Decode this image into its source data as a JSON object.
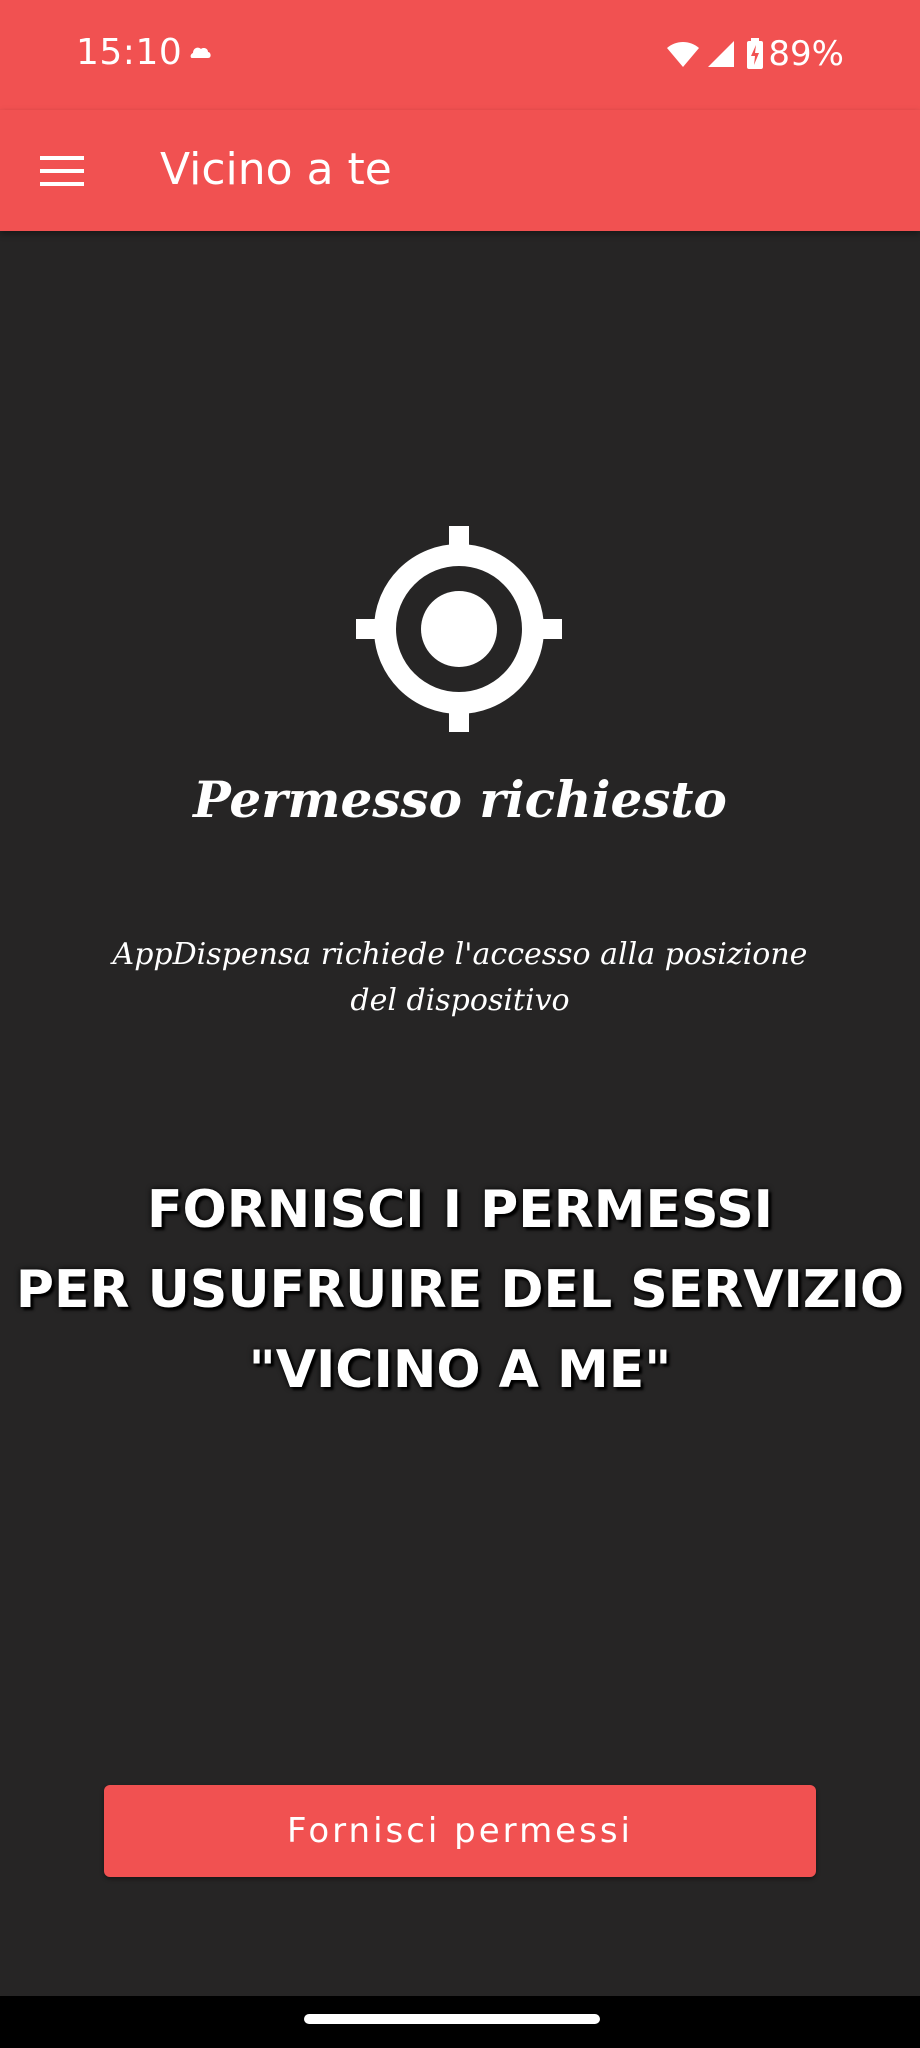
{
  "status_bar": {
    "time": "15:10",
    "battery": "89%",
    "icons": [
      "notification-icon",
      "wifi-icon",
      "signal-icon",
      "battery-charging-icon"
    ]
  },
  "app_bar": {
    "title": "Vicino a te",
    "menu_icon": "hamburger-menu-icon",
    "color": "#f15151"
  },
  "permission": {
    "icon": "gps-target-icon",
    "title": "Permesso richiesto",
    "description": "AppDispensa richiede l'accesso alla posizione del dispositivo"
  },
  "headline": {
    "line1": "FORNISCI I PERMESSI",
    "line2": "PER USUFRUIRE DEL SERVIZIO",
    "line3": "\"VICINO A ME\""
  },
  "button": {
    "label": "Fornisci permessi"
  },
  "colors": {
    "accent": "#f15151",
    "background": "#262525",
    "text": "#ffffff"
  }
}
